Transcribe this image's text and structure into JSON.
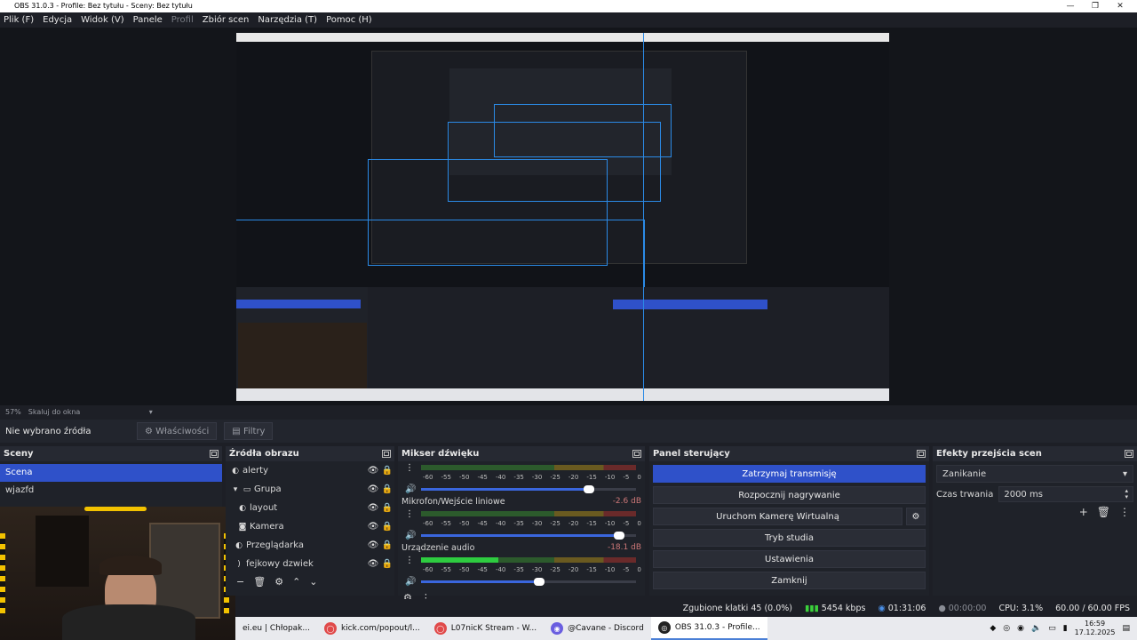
{
  "window": {
    "title": "OBS 31.0.3 - Profile: Bez tytułu - Sceny: Bez tytułu"
  },
  "menu": [
    {
      "label": "Plik (F)",
      "dim": false
    },
    {
      "label": "Edycja",
      "dim": false
    },
    {
      "label": "Widok (V)",
      "dim": false
    },
    {
      "label": "Panele",
      "dim": false
    },
    {
      "label": "Profil",
      "dim": true
    },
    {
      "label": "Zbiór scen",
      "dim": false
    },
    {
      "label": "Narzędzia (T)",
      "dim": false
    },
    {
      "label": "Pomoc (H)",
      "dim": false
    }
  ],
  "zoom": {
    "percent": "57%",
    "mode": "Skaluj do okna"
  },
  "source_bar": {
    "status": "Nie wybrano źródła",
    "properties": "Właściwości",
    "filters": "Filtry"
  },
  "scenes": {
    "title": "Sceny",
    "items": [
      "Scena",
      "wjazfd"
    ]
  },
  "sources": {
    "title": "Źródła obrazu",
    "items": [
      "alerty",
      "Grupa",
      "layout",
      "Kamera",
      "Przeglądarka",
      "fejkowy dzwiek"
    ]
  },
  "mixer": {
    "title": "Mikser dźwięku",
    "scale": [
      "-60",
      "-55",
      "-50",
      "-45",
      "-40",
      "-35",
      "-30",
      "-25",
      "-20",
      "-15",
      "-10",
      "-5",
      "0"
    ],
    "channels": [
      {
        "name": "",
        "db": "",
        "level": 0,
        "volume": 0.78
      },
      {
        "name": "Mikrofon/Wejście liniowe",
        "db": "-2.6 dB",
        "level": 0,
        "volume": 0.92
      },
      {
        "name": "Urządzenie audio",
        "db": "-18.1 dB",
        "level": 0.36,
        "volume": 0.55
      }
    ]
  },
  "controls": {
    "title": "Panel sterujący",
    "stop_stream": "Zatrzymaj transmisję",
    "start_record": "Rozpocznij nagrywanie",
    "virtual_cam": "Uruchom Kamerę Wirtualną",
    "studio_mode": "Tryb studia",
    "settings": "Ustawienia",
    "exit": "Zamknij"
  },
  "transitions": {
    "title": "Efekty przejścia scen",
    "selected": "Zanikanie",
    "duration_label": "Czas trwania",
    "duration_value": "2000 ms"
  },
  "status": {
    "dropped": "Zgubione klatki 45 (0.0%)",
    "bitrate": "5454 kbps",
    "stream_time": "01:31:06",
    "record_time": "00:00:00",
    "cpu": "CPU: 3.1%",
    "fps": "60.00 / 60.00 FPS"
  },
  "taskbar": {
    "tasks": [
      "ei.eu | Chłopak...",
      "kick.com/popout/l...",
      "L07nicK Stream - W...",
      "@Cavane - Discord",
      "OBS 31.0.3 - Profile..."
    ],
    "time": "16:59",
    "date": "17.12.2025"
  },
  "colors": {
    "accent": "#2f51c9",
    "bg": "#1d1f26",
    "panel": "#1f2229"
  }
}
